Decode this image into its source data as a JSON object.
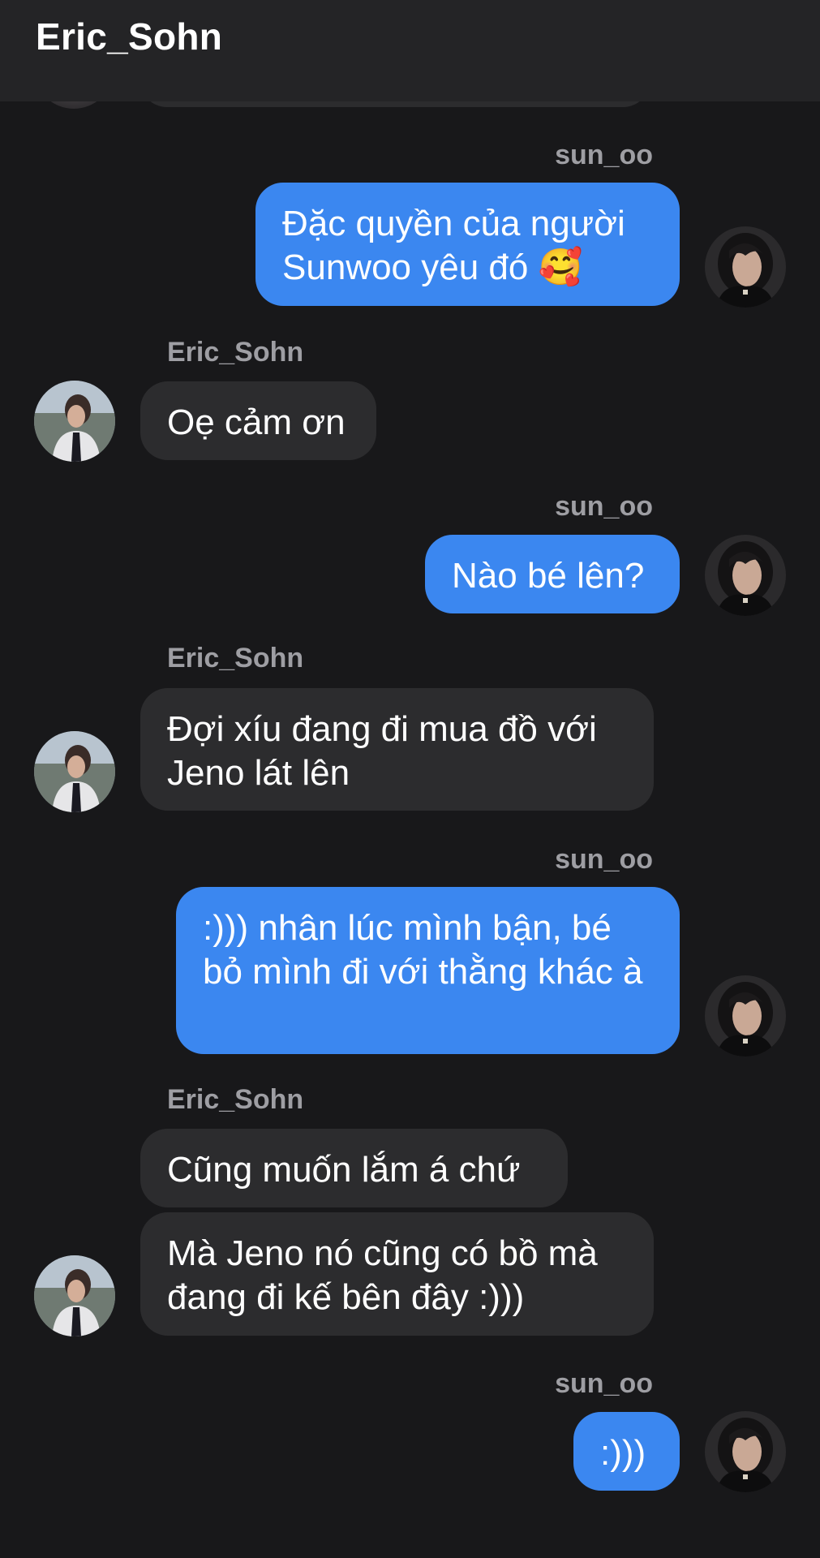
{
  "header": {
    "title": "Eric_Sohn"
  },
  "messages": [
    {
      "sender": "sun_oo",
      "direction": "outgoing",
      "text": "Đặc quyền của người Sunwoo yêu đó 🥰"
    },
    {
      "sender": "Eric_Sohn",
      "direction": "incoming",
      "text": "Oẹ cảm ơn"
    },
    {
      "sender": "sun_oo",
      "direction": "outgoing",
      "text": "Nào bé lên?"
    },
    {
      "sender": "Eric_Sohn",
      "direction": "incoming",
      "text": "Đợi xíu đang đi mua đồ với Jeno lát lên"
    },
    {
      "sender": "sun_oo",
      "direction": "outgoing",
      "text": ":))) nhân lúc mình bận, bé bỏ mình đi với thằng khác à"
    },
    {
      "sender": "Eric_Sohn",
      "direction": "incoming",
      "text": "Cũng muốn lắm á chứ"
    },
    {
      "sender": "Eric_Sohn",
      "direction": "incoming",
      "text": "Mà Jeno nó cũng có bồ mà đang đi kế bên đây :)))"
    },
    {
      "sender": "sun_oo",
      "direction": "outgoing",
      "text": ":)))"
    }
  ],
  "colors": {
    "background": "#18181a",
    "header": "#242426",
    "outgoing_bubble": "#3b87f0",
    "incoming_bubble": "#2c2c2e",
    "sender_name": "#9e9ea3"
  },
  "icons": {
    "avatar_outgoing": "avatar-sun-oo-icon",
    "avatar_incoming": "avatar-eric-sohn-icon"
  }
}
